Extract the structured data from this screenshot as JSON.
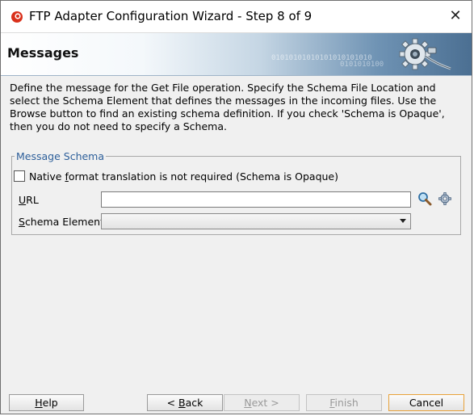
{
  "window": {
    "title": "FTP Adapter Configuration Wizard - Step 8 of 9",
    "close_glyph": "✕"
  },
  "banner": {
    "heading": "Messages",
    "binary_text": "01010101010101010101010",
    "binary_text2": "0101010100",
    "art_icon": "gear-plug-icon"
  },
  "description": "Define the message for the Get File operation.  Specify the Schema File Location and select the Schema Element that defines the messages in the incoming files. Use the Browse button to find an existing schema definition. If you check 'Schema is Opaque', then you do not need to specify a Schema.",
  "message_schema": {
    "legend": "Message Schema",
    "opaque_checkbox": {
      "pre": "Native ",
      "mnemonic": "f",
      "post": "ormat translation is not required (Schema is Opaque)",
      "checked": false
    },
    "url": {
      "mnemonic": "U",
      "rest": "RL",
      "value": "",
      "search_icon": "magnifier-icon",
      "settings_icon": "gear-icon"
    },
    "schema_element": {
      "mnemonic": "S",
      "rest": "chema Element",
      "selected": ""
    }
  },
  "buttons": {
    "help": {
      "mnemonic": "H",
      "rest": "elp"
    },
    "back": {
      "pre": "< ",
      "mnemonic": "B",
      "rest": "ack"
    },
    "next": {
      "mnemonic": "N",
      "rest": "ext >"
    },
    "finish": {
      "mnemonic": "F",
      "rest": "inish"
    },
    "cancel": {
      "label": "Cancel"
    }
  },
  "colors": {
    "legend": "#2d5f9a",
    "default_button_border": "#e8a23a",
    "banner_dark": "#4b6f92"
  }
}
